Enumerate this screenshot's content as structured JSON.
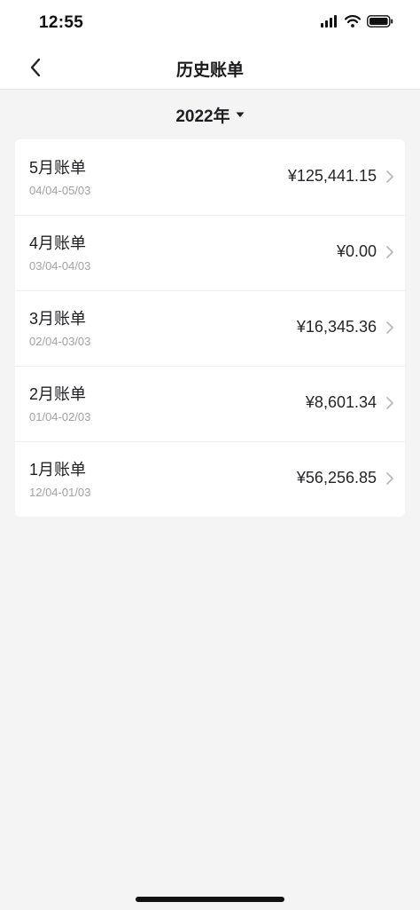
{
  "status_bar": {
    "time": "12:55"
  },
  "header": {
    "title": "历史账单"
  },
  "year_picker": {
    "label": "2022年"
  },
  "bills": [
    {
      "title": "5月账单",
      "range": "04/04-05/03",
      "amount": "¥125,441.15"
    },
    {
      "title": "4月账单",
      "range": "03/04-04/03",
      "amount": "¥0.00"
    },
    {
      "title": "3月账单",
      "range": "02/04-03/03",
      "amount": "¥16,345.36"
    },
    {
      "title": "2月账单",
      "range": "01/04-02/03",
      "amount": "¥8,601.34"
    },
    {
      "title": "1月账单",
      "range": "12/04-01/03",
      "amount": "¥56,256.85"
    }
  ],
  "colors": {
    "background": "#f4f4f5",
    "card": "#ffffff",
    "secondary_text": "#a2a2a8"
  }
}
